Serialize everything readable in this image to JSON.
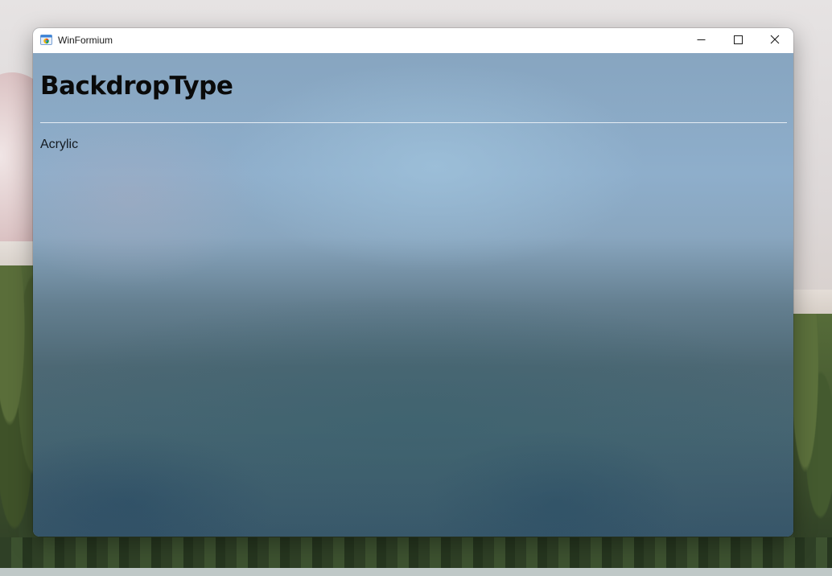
{
  "window": {
    "title": "WinFormium",
    "app_icon": "browser-icon",
    "controls": {
      "minimize_icon": "minimize-icon",
      "maximize_icon": "maximize-icon",
      "close_icon": "close-icon"
    }
  },
  "content": {
    "heading": "BackdropType",
    "value": "Acrylic"
  },
  "colors": {
    "titlebar": "#ffffff",
    "text": "#0a0a0a",
    "divider": "#eef3f7"
  }
}
